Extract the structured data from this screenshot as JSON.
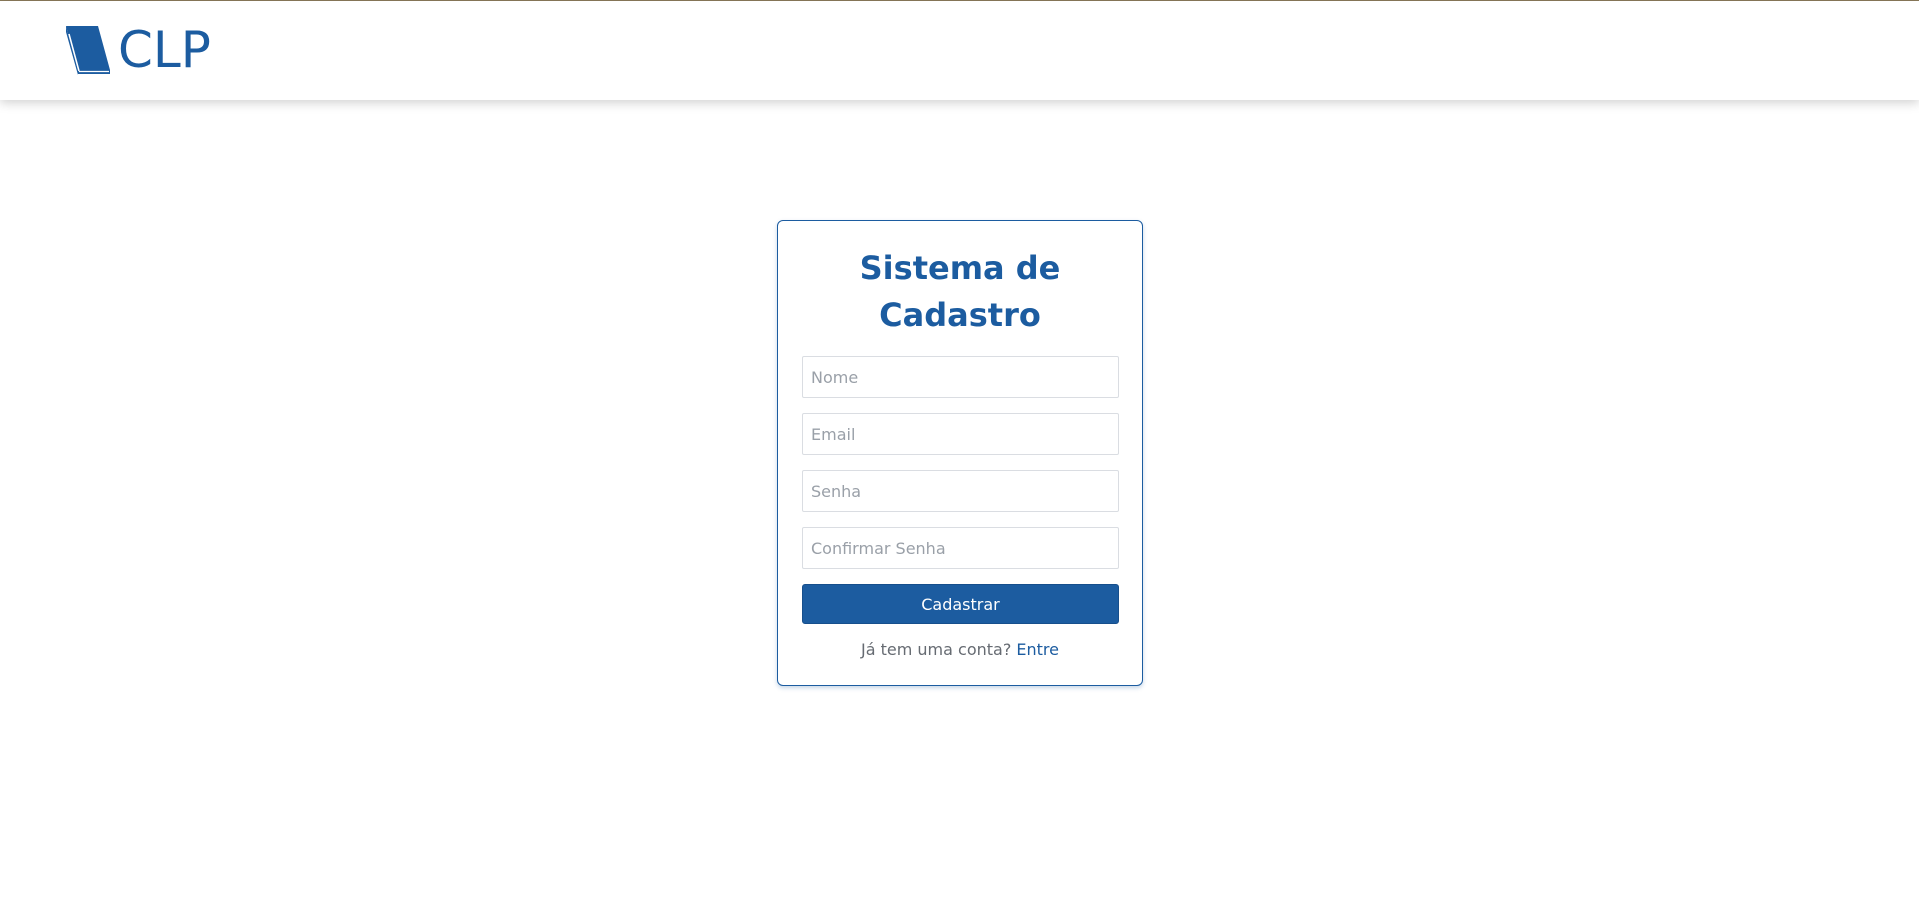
{
  "header": {
    "brand_text": "CLP",
    "logo_icon": "book-icon",
    "accent_color": "#1c5ca0"
  },
  "form": {
    "title_line1": "Sistema de",
    "title_line2": "Cadastro",
    "name_placeholder": "Nome",
    "email_placeholder": "Email",
    "password_placeholder": "Senha",
    "confirm_password_placeholder": "Confirmar Senha",
    "submit_label": "Cadastrar",
    "login_prompt": "Já tem uma conta?",
    "login_link": "Entre"
  }
}
